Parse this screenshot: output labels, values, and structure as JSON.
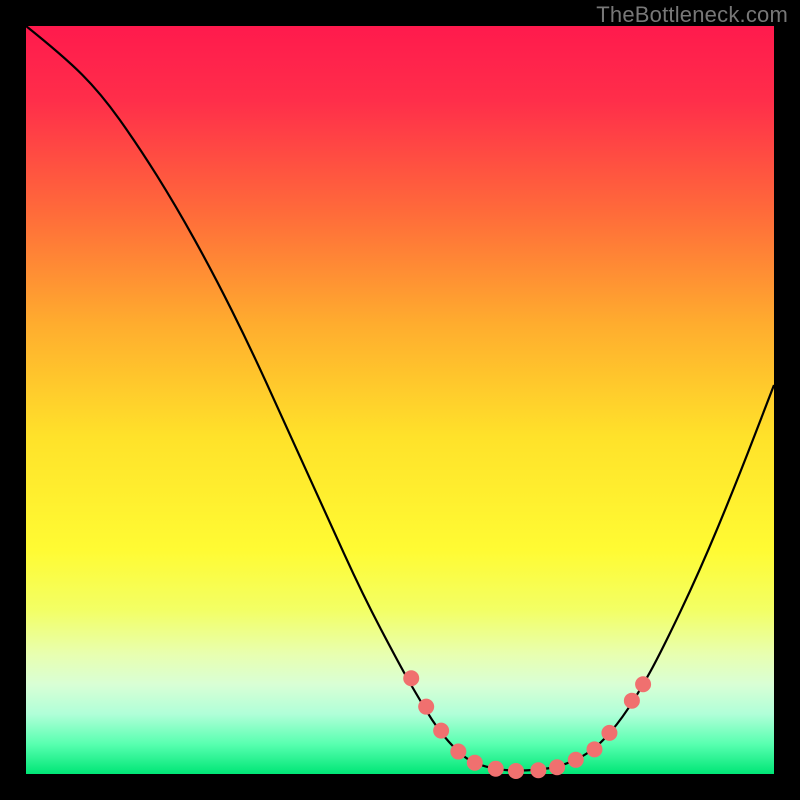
{
  "watermark": "TheBottleneck.com",
  "chart_data": {
    "type": "line",
    "title": "",
    "xlabel": "",
    "ylabel": "",
    "xlim": [
      0,
      100
    ],
    "ylim": [
      0,
      100
    ],
    "curve": [
      {
        "x": 0,
        "y": 100
      },
      {
        "x": 5,
        "y": 96
      },
      {
        "x": 10,
        "y": 91
      },
      {
        "x": 15,
        "y": 84
      },
      {
        "x": 20,
        "y": 76
      },
      {
        "x": 25,
        "y": 67
      },
      {
        "x": 30,
        "y": 57
      },
      {
        "x": 35,
        "y": 46
      },
      {
        "x": 40,
        "y": 35
      },
      {
        "x": 45,
        "y": 24
      },
      {
        "x": 50,
        "y": 14.5
      },
      {
        "x": 52,
        "y": 11
      },
      {
        "x": 55,
        "y": 6.0
      },
      {
        "x": 58,
        "y": 2.7
      },
      {
        "x": 60,
        "y": 1.4
      },
      {
        "x": 63,
        "y": 0.6
      },
      {
        "x": 66,
        "y": 0.4
      },
      {
        "x": 70,
        "y": 0.7
      },
      {
        "x": 73,
        "y": 1.6
      },
      {
        "x": 76,
        "y": 3.3
      },
      {
        "x": 79,
        "y": 6.5
      },
      {
        "x": 82,
        "y": 11
      },
      {
        "x": 85,
        "y": 16.5
      },
      {
        "x": 90,
        "y": 27
      },
      {
        "x": 95,
        "y": 39
      },
      {
        "x": 100,
        "y": 52
      }
    ],
    "ideal_zone_points": [
      {
        "x": 51.5,
        "y": 12.8
      },
      {
        "x": 53.5,
        "y": 9.0
      },
      {
        "x": 55.5,
        "y": 5.8
      },
      {
        "x": 57.8,
        "y": 3.0
      },
      {
        "x": 60.0,
        "y": 1.5
      },
      {
        "x": 62.8,
        "y": 0.7
      },
      {
        "x": 65.5,
        "y": 0.4
      },
      {
        "x": 68.5,
        "y": 0.5
      },
      {
        "x": 71.0,
        "y": 0.9
      },
      {
        "x": 73.5,
        "y": 1.9
      },
      {
        "x": 76.0,
        "y": 3.3
      },
      {
        "x": 78.0,
        "y": 5.5
      },
      {
        "x": 81.0,
        "y": 9.8
      },
      {
        "x": 82.5,
        "y": 12.0
      }
    ],
    "gradient_stops": [
      {
        "offset": 0.0,
        "color": "#ff1a4d"
      },
      {
        "offset": 0.1,
        "color": "#ff2e4a"
      },
      {
        "offset": 0.25,
        "color": "#ff6b3a"
      },
      {
        "offset": 0.4,
        "color": "#ffad2e"
      },
      {
        "offset": 0.55,
        "color": "#ffe22a"
      },
      {
        "offset": 0.7,
        "color": "#fffb33"
      },
      {
        "offset": 0.78,
        "color": "#f3ff64"
      },
      {
        "offset": 0.84,
        "color": "#e8ffb0"
      },
      {
        "offset": 0.88,
        "color": "#d9ffd5"
      },
      {
        "offset": 0.92,
        "color": "#b0ffd8"
      },
      {
        "offset": 0.96,
        "color": "#58ffb0"
      },
      {
        "offset": 1.0,
        "color": "#00e676"
      }
    ],
    "dot_color": "#f0706f",
    "dot_radius_px": 8
  }
}
